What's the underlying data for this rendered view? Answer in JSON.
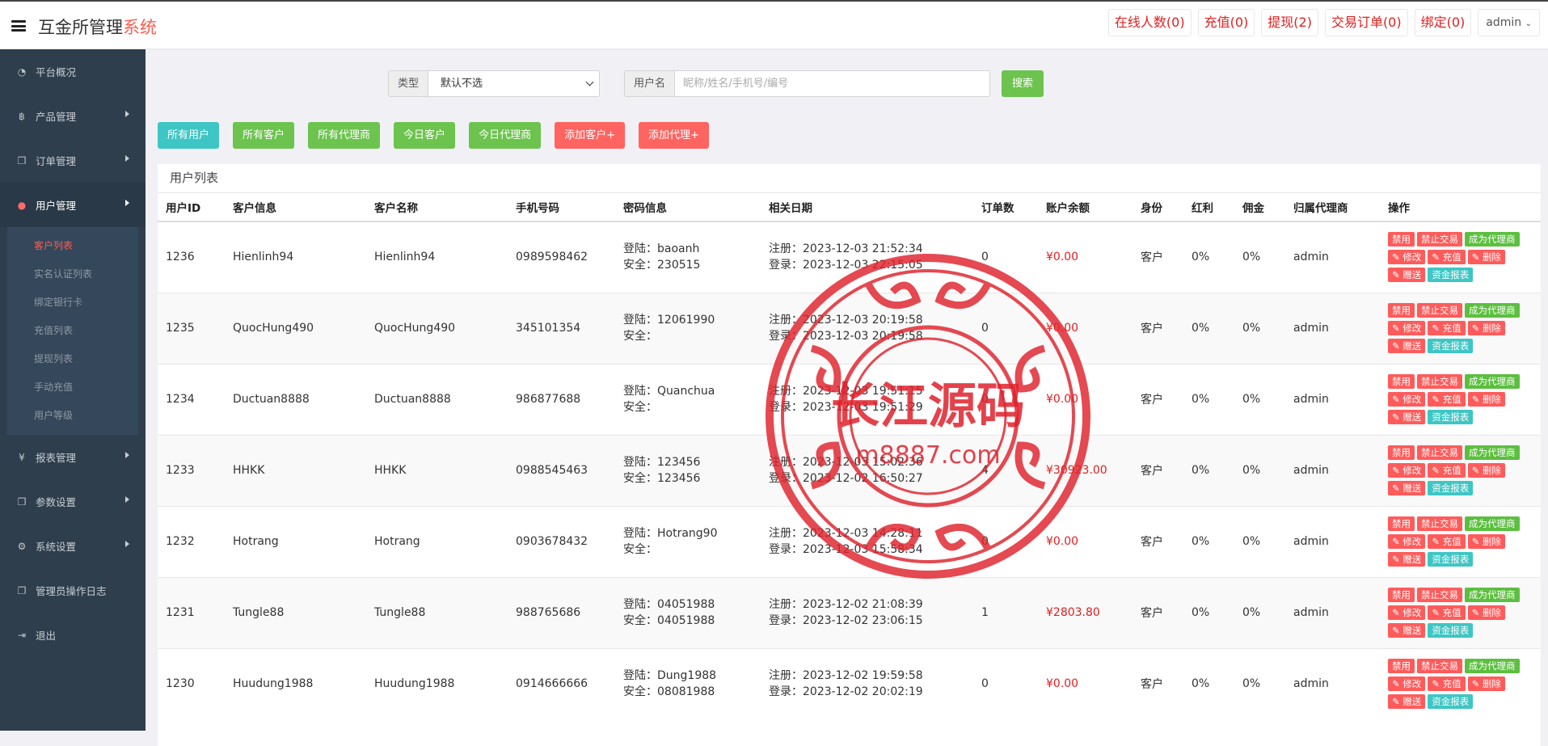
{
  "header": {
    "title_main": "互金所管理",
    "title_accent": "系统",
    "actions": [
      "在线人数(0)",
      "充值(0)",
      "提现(2)",
      "交易订单(0)",
      "绑定(0)"
    ],
    "user": "admin"
  },
  "sidebar": {
    "items": [
      {
        "label": "平台概况",
        "icon": "dashboard-icon"
      },
      {
        "label": "产品管理",
        "icon": "bitcoin-icon"
      },
      {
        "label": "订单管理",
        "icon": "copy-icon"
      },
      {
        "label": "用户管理",
        "icon": "user-icon"
      },
      {
        "label": "报表管理",
        "icon": "yen-icon"
      },
      {
        "label": "参数设置",
        "icon": "copy-icon"
      },
      {
        "label": "系统设置",
        "icon": "cogs-icon"
      },
      {
        "label": "管理员操作日志",
        "icon": "copy-icon"
      },
      {
        "label": "退出",
        "icon": "signout-icon"
      }
    ],
    "sub_items": [
      "客户列表",
      "实名认证列表",
      "绑定银行卡",
      "充值列表",
      "提现列表",
      "手动充值",
      "用户等级"
    ]
  },
  "search": {
    "type_label": "类型",
    "type_value": "默认不选",
    "user_label": "用户名",
    "user_placeholder": "昵称/姓名/手机号/编号",
    "button": "搜索"
  },
  "filters": [
    "所有用户",
    "所有客户",
    "所有代理商",
    "今日客户",
    "今日代理商",
    "添加客户+",
    "添加代理+"
  ],
  "table": {
    "title": "用户列表",
    "columns": [
      "用户ID",
      "客户信息",
      "客户名称",
      "手机号码",
      "密码信息",
      "相关日期",
      "订单数",
      "账户余额",
      "身份",
      "红利",
      "佣金",
      "归属代理商",
      "操作"
    ],
    "ops": [
      "禁用",
      "禁止交易",
      "成为代理商",
      "修改",
      "充值",
      "删除",
      "赠送",
      "资金报表"
    ],
    "rows": [
      {
        "id": "1236",
        "info": "Hienlinh94",
        "name": "Hienlinh94",
        "phone": "0989598462",
        "login": "登陆：baoanh",
        "safe": "安全：230515",
        "reg": "注册：2023-12-03 21:52:34",
        "last": "登录：2023-12-03 22:15:05",
        "orders": "0",
        "balance": "¥0.00",
        "role": "客户",
        "bonus": "0%",
        "commission": "0%",
        "agent": "admin"
      },
      {
        "id": "1235",
        "info": "QuocHung490",
        "name": "QuocHung490",
        "phone": "345101354",
        "login": "登陆：12061990",
        "safe": "安全：",
        "reg": "注册：2023-12-03 20:19:58",
        "last": "登录：2023-12-03 20:19:58",
        "orders": "0",
        "balance": "¥0.00",
        "role": "客户",
        "bonus": "0%",
        "commission": "0%",
        "agent": "admin"
      },
      {
        "id": "1234",
        "info": "Ductuan8888",
        "name": "Ductuan8888",
        "phone": "986877688",
        "login": "登陆：Quanchua",
        "safe": "安全：",
        "reg": "注册：2023-12-03 19:51:15",
        "last": "登录：2023-12-03 19:51:29",
        "orders": "0",
        "balance": "¥0.00",
        "role": "客户",
        "bonus": "0%",
        "commission": "0%",
        "agent": "admin"
      },
      {
        "id": "1233",
        "info": "HHKK",
        "name": "HHKK",
        "phone": "0988545463",
        "login": "登陆：123456",
        "safe": "安全：123456",
        "reg": "注册：2023-12-03 15:02:36",
        "last": "登录：2023-12-02 16:50:27",
        "orders": "4",
        "balance": "¥30923.00",
        "role": "客户",
        "bonus": "0%",
        "commission": "0%",
        "agent": "admin"
      },
      {
        "id": "1232",
        "info": "Hotrang",
        "name": "Hotrang",
        "phone": "0903678432",
        "login": "登陆：Hotrang90",
        "safe": "安全：",
        "reg": "注册：2023-12-03 14:28:11",
        "last": "登录：2023-12-03 15:58:34",
        "orders": "0",
        "balance": "¥0.00",
        "role": "客户",
        "bonus": "0%",
        "commission": "0%",
        "agent": "admin"
      },
      {
        "id": "1231",
        "info": "Tungle88",
        "name": "Tungle88",
        "phone": "988765686",
        "login": "登陆：04051988",
        "safe": "安全：04051988",
        "reg": "注册：2023-12-02 21:08:39",
        "last": "登录：2023-12-02 23:06:15",
        "orders": "1",
        "balance": "¥2803.80",
        "role": "客户",
        "bonus": "0%",
        "commission": "0%",
        "agent": "admin"
      },
      {
        "id": "1230",
        "info": "Huudung1988",
        "name": "Huudung1988",
        "phone": "0914666666",
        "login": "登陆：Dung1988",
        "safe": "安全：08081988",
        "reg": "注册：2023-12-02 19:59:58",
        "last": "登录：2023-12-02 20:02:19",
        "orders": "0",
        "balance": "¥0.00",
        "role": "客户",
        "bonus": "0%",
        "commission": "0%",
        "agent": "admin"
      }
    ]
  },
  "watermark": {
    "text_cn": "长江源码",
    "text_url": "m8887.com"
  },
  "colors": {
    "accent": "#ff5b50",
    "sidebar": "#2e3e4d",
    "green": "#6cc34e",
    "teal": "#3ec6c4",
    "red": "#ff6461"
  }
}
